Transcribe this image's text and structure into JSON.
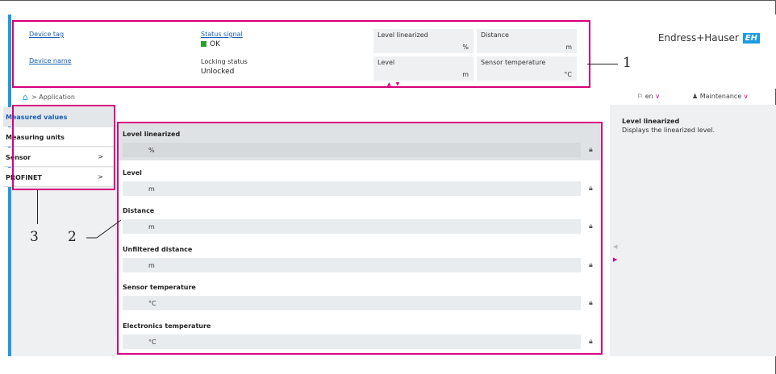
{
  "header": {
    "device_tag": "Device tag",
    "device_name": "Device name",
    "status_signal_label": "Status signal",
    "status_signal_value": "OK",
    "locking_status_label": "Locking status",
    "locking_status_value": "Unlocked",
    "tiles": [
      {
        "label": "Level linearized",
        "unit": "%"
      },
      {
        "label": "Distance",
        "unit": "m"
      },
      {
        "label": "Level",
        "unit": "m"
      },
      {
        "label": "Sensor temperature",
        "unit": "°C"
      }
    ],
    "brand": "Endress+Hauser",
    "logo": "EH"
  },
  "breadcrumb": {
    "current": "Application"
  },
  "toolbar": {
    "language": "en",
    "role": "Maintenance"
  },
  "nav": {
    "items": [
      {
        "label": "Measured values",
        "selected": true,
        "has_submenu": false
      },
      {
        "label": "Measuring units",
        "selected": false,
        "has_submenu": false
      },
      {
        "label": "Sensor",
        "selected": false,
        "has_submenu": true
      },
      {
        "label": "PROFINET",
        "selected": false,
        "has_submenu": true
      }
    ]
  },
  "parameters": [
    {
      "label": "Level linearized",
      "unit": "%"
    },
    {
      "label": "Level",
      "unit": "m"
    },
    {
      "label": "Distance",
      "unit": "m"
    },
    {
      "label": "Unfiltered distance",
      "unit": "m"
    },
    {
      "label": "Sensor temperature",
      "unit": "°C"
    },
    {
      "label": "Electronics temperature",
      "unit": "°C"
    }
  ],
  "help": {
    "title": "Level linearized",
    "text": "Displays the linearized level."
  },
  "callouts": [
    "1",
    "2",
    "3"
  ],
  "colors": {
    "accent": "#1e9be0",
    "highlight": "#d6007d",
    "ok": "#2aa22a"
  }
}
